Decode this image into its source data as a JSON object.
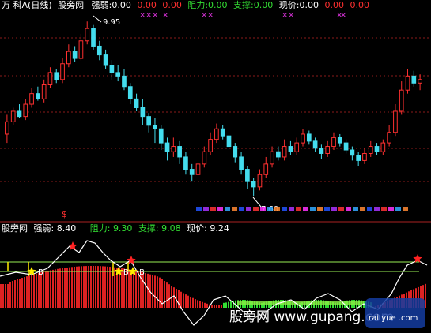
{
  "top_bar": {
    "prefix": "万  科A(日线)",
    "site": "股旁网",
    "items": [
      {
        "label": "强弱:",
        "value": "0.00",
        "color": "#ffffff"
      },
      {
        "label": "",
        "value": "0.00",
        "color": "#ff3030"
      },
      {
        "label": "",
        "value": "0.00",
        "color": "#ff3030"
      },
      {
        "label": "阻力:",
        "value": "0.00",
        "color": "#33dd33"
      },
      {
        "label": "支撑:",
        "value": "0.00",
        "color": "#33dd33"
      },
      {
        "label": "现价:",
        "value": "0.00",
        "color": "#ffffff"
      },
      {
        "label": "",
        "value": "0.00",
        "color": "#ff3030"
      },
      {
        "label": "",
        "value": "0.00",
        "color": "#ff3030"
      }
    ]
  },
  "bottom_bar": {
    "site": "股旁网",
    "items": [
      {
        "label": "强弱:",
        "value": "8.40",
        "color": "#ffffff"
      },
      {
        "label": "阻力:",
        "value": "9.30",
        "color": "#33dd33"
      },
      {
        "label": "支撑:",
        "value": "9.08",
        "color": "#33dd33"
      },
      {
        "label": "现价:",
        "value": "9.24",
        "color": "#ffffff"
      }
    ]
  },
  "watermark": {
    "text": "股旁网 www.gupang.com",
    "logo": "rai yue .com"
  },
  "chart_data": [
    {
      "type": "candlestick",
      "annotations": {
        "high_label": "9.95",
        "low_label": "7.60",
        "dollar_marker": "$"
      },
      "colors": {
        "up": "#ff3030",
        "down": "#44ddee",
        "grid": "#8a1a1a"
      },
      "ohlc_lowres_norm": [
        [
          0.35,
          0.42,
          0.3,
          0.46
        ],
        [
          0.42,
          0.48,
          0.4,
          0.5
        ],
        [
          0.48,
          0.45,
          0.44,
          0.52
        ],
        [
          0.45,
          0.52,
          0.43,
          0.55
        ],
        [
          0.52,
          0.58,
          0.5,
          0.61
        ],
        [
          0.58,
          0.55,
          0.54,
          0.62
        ],
        [
          0.55,
          0.63,
          0.53,
          0.66
        ],
        [
          0.63,
          0.7,
          0.61,
          0.73
        ],
        [
          0.7,
          0.66,
          0.64,
          0.72
        ],
        [
          0.66,
          0.75,
          0.64,
          0.78
        ],
        [
          0.75,
          0.82,
          0.73,
          0.86
        ],
        [
          0.82,
          0.78,
          0.76,
          0.85
        ],
        [
          0.78,
          0.88,
          0.77,
          0.92
        ],
        [
          0.88,
          0.95,
          0.86,
          0.99
        ],
        [
          0.95,
          0.85,
          0.83,
          0.97
        ],
        [
          0.85,
          0.8,
          0.77,
          0.88
        ],
        [
          0.8,
          0.74,
          0.72,
          0.83
        ],
        [
          0.74,
          0.7,
          0.66,
          0.77
        ],
        [
          0.7,
          0.68,
          0.65,
          0.74
        ],
        [
          0.68,
          0.62,
          0.6,
          0.72
        ],
        [
          0.62,
          0.55,
          0.52,
          0.64
        ],
        [
          0.55,
          0.5,
          0.48,
          0.58
        ],
        [
          0.5,
          0.45,
          0.4,
          0.55
        ],
        [
          0.45,
          0.4,
          0.36,
          0.47
        ],
        [
          0.4,
          0.38,
          0.3,
          0.44
        ],
        [
          0.38,
          0.3,
          0.26,
          0.4
        ],
        [
          0.3,
          0.25,
          0.2,
          0.33
        ],
        [
          0.25,
          0.28,
          0.22,
          0.33
        ],
        [
          0.28,
          0.22,
          0.18,
          0.31
        ],
        [
          0.22,
          0.15,
          0.12,
          0.25
        ],
        [
          0.15,
          0.12,
          0.08,
          0.18
        ],
        [
          0.12,
          0.18,
          0.1,
          0.21
        ],
        [
          0.18,
          0.25,
          0.16,
          0.28
        ],
        [
          0.25,
          0.32,
          0.23,
          0.36
        ],
        [
          0.32,
          0.38,
          0.3,
          0.41
        ],
        [
          0.38,
          0.34,
          0.32,
          0.4
        ],
        [
          0.34,
          0.28,
          0.25,
          0.36
        ],
        [
          0.28,
          0.22,
          0.19,
          0.3
        ],
        [
          0.22,
          0.15,
          0.12,
          0.25
        ],
        [
          0.15,
          0.08,
          0.04,
          0.17
        ],
        [
          0.08,
          0.05,
          0.0,
          0.1
        ],
        [
          0.05,
          0.12,
          0.03,
          0.15
        ],
        [
          0.12,
          0.18,
          0.1,
          0.22
        ],
        [
          0.18,
          0.25,
          0.16,
          0.28
        ],
        [
          0.25,
          0.22,
          0.2,
          0.28
        ],
        [
          0.22,
          0.28,
          0.2,
          0.32
        ],
        [
          0.28,
          0.25,
          0.23,
          0.31
        ],
        [
          0.25,
          0.3,
          0.23,
          0.33
        ],
        [
          0.3,
          0.35,
          0.28,
          0.38
        ],
        [
          0.35,
          0.31,
          0.29,
          0.37
        ],
        [
          0.31,
          0.27,
          0.25,
          0.33
        ],
        [
          0.27,
          0.24,
          0.21,
          0.29
        ],
        [
          0.24,
          0.28,
          0.22,
          0.31
        ],
        [
          0.28,
          0.33,
          0.26,
          0.36
        ],
        [
          0.33,
          0.3,
          0.28,
          0.35
        ],
        [
          0.3,
          0.26,
          0.24,
          0.32
        ],
        [
          0.26,
          0.23,
          0.2,
          0.28
        ],
        [
          0.23,
          0.2,
          0.17,
          0.25
        ],
        [
          0.2,
          0.24,
          0.18,
          0.27
        ],
        [
          0.24,
          0.28,
          0.22,
          0.31
        ],
        [
          0.28,
          0.25,
          0.23,
          0.3
        ],
        [
          0.25,
          0.3,
          0.23,
          0.32
        ],
        [
          0.3,
          0.36,
          0.28,
          0.4
        ],
        [
          0.36,
          0.48,
          0.34,
          0.52
        ],
        [
          0.48,
          0.6,
          0.46,
          0.65
        ],
        [
          0.6,
          0.68,
          0.58,
          0.72
        ],
        [
          0.68,
          0.64,
          0.62,
          0.71
        ],
        [
          0.64,
          0.66,
          0.6,
          0.69
        ]
      ],
      "y_unit": "normalized (0 = 7.60, 1 = 9.95)"
    },
    {
      "type": "indicator",
      "series": [
        {
          "name": "强弱",
          "color": "#ffffff"
        },
        {
          "name": "阻力",
          "color": "#99ee55"
        },
        {
          "name": "支撑",
          "color": "#99ee55"
        }
      ],
      "markers": [
        {
          "label": "B"
        },
        {
          "label": "B"
        },
        {
          "label": "B"
        }
      ]
    }
  ]
}
